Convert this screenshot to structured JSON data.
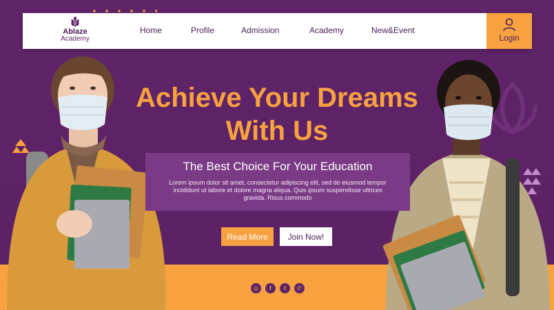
{
  "logo": {
    "name": "Ablaze",
    "subtitle": "Academy"
  },
  "nav": {
    "items": [
      {
        "label": "Home"
      },
      {
        "label": "Profile"
      },
      {
        "label": "Admission"
      },
      {
        "label": "Academy"
      },
      {
        "label": "New&Event"
      }
    ],
    "login_label": "Login",
    "login_icon": "user-icon"
  },
  "hero": {
    "title_line1": "Achieve Your Dreams",
    "title_line2": "With Us",
    "subtitle": "The Best Choice For Your Education",
    "body": "Lorem ipsum dolor sit amet, consectetur adipiscing elit, sed do eiusmod tempor incididunt ut labore et dolore magna aliqua. Quis ipsum suspendisse ultrices gravida. Risus commodo",
    "read_more_label": "Read More",
    "join_label": "Join Now!"
  },
  "socials": [
    {
      "name": "instagram-icon",
      "glyph": "◎"
    },
    {
      "name": "facebook-icon",
      "glyph": "f"
    },
    {
      "name": "twitter-icon",
      "glyph": "t"
    },
    {
      "name": "whatsapp-icon",
      "glyph": "✆"
    }
  ],
  "colors": {
    "purple": "#5e2466",
    "orange": "#f7a141",
    "white": "#ffffff"
  }
}
